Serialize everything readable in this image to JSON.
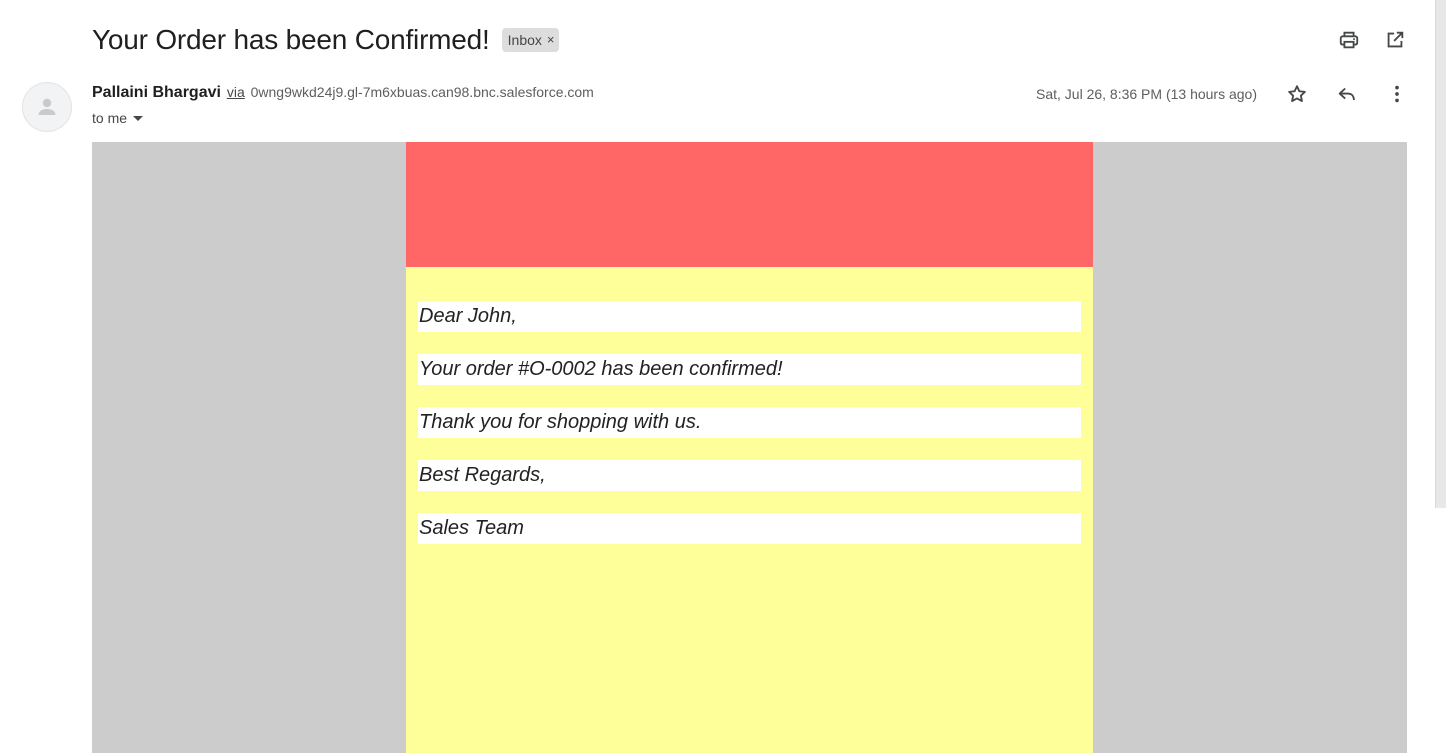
{
  "subject": "Your Order has been Confirmed!",
  "label": {
    "text": "Inbox",
    "remove": "×"
  },
  "sender": {
    "name": "Pallaini Bhargavi",
    "via": "via",
    "address": "0wng9wkd24j9.gl-7m6xbuas.can98.bnc.salesforce.com",
    "to": "to me"
  },
  "date": "Sat, Jul 26, 8:36 PM (13 hours ago)",
  "icons": {
    "print": "print-icon",
    "open_new": "open-in-new-window-icon",
    "star": "star-icon",
    "reply": "reply-icon",
    "more": "more-vertical-icon",
    "avatar": "default-avatar-icon"
  },
  "email": {
    "lines": [
      "Dear John,",
      "Your order #O-0002 has been confirmed!",
      "Thank you for shopping with us.",
      "Best Regards,",
      "Sales Team"
    ]
  },
  "colors": {
    "banner": "#ff6666",
    "card": "#ffff99",
    "backdrop": "#cccccc"
  }
}
